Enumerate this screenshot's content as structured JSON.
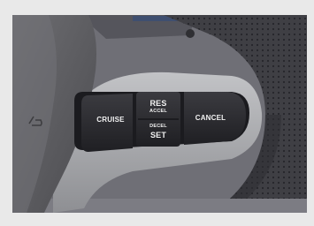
{
  "photo": {
    "subject": "steering wheel cruise control buttons",
    "colors": {
      "frame": "#e9e9e9",
      "wheel": "#5e5e61",
      "leather": "#444449",
      "bezel": "#a9aaad",
      "button": "#2b2b2f",
      "button_text": "#f2f2f2",
      "dash": "#6f6f76"
    }
  },
  "buttons": {
    "cruise": {
      "label": "CRUISE"
    },
    "res_accel": {
      "top_label": "RES",
      "top_sub": "ACCEL",
      "bottom_sub": "DECEL",
      "bottom_label": "SET"
    },
    "cancel": {
      "label": "CANCEL"
    }
  },
  "icons": {
    "horn": "horn-icon"
  }
}
